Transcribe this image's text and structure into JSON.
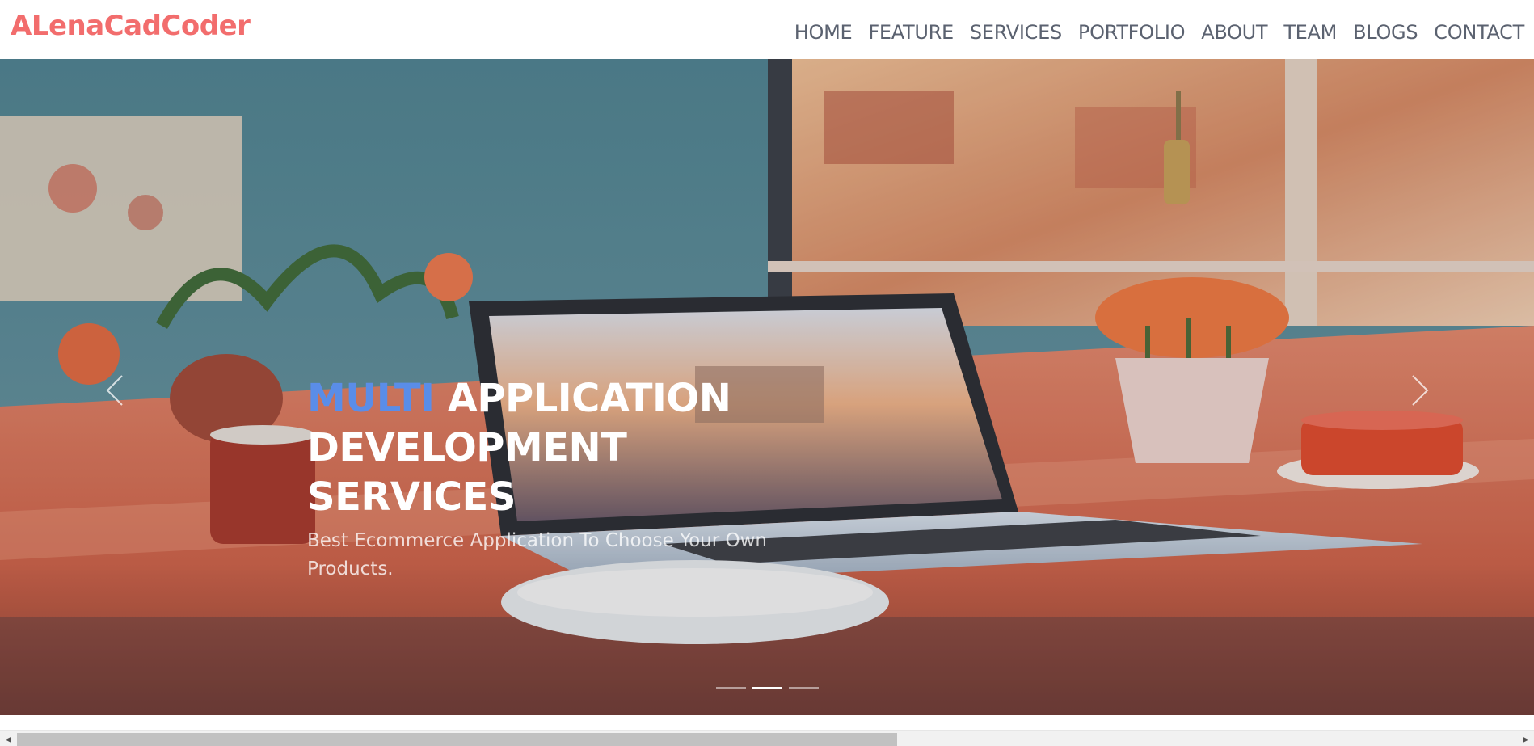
{
  "header": {
    "brand": "ALenaCadCoder",
    "nav": [
      {
        "label": "HOME"
      },
      {
        "label": "FEATURE"
      },
      {
        "label": "SERVICES"
      },
      {
        "label": "PORTFOLIO"
      },
      {
        "label": "ABOUT"
      },
      {
        "label": "TEAM"
      },
      {
        "label": "BLOGS"
      },
      {
        "label": "CONTACT"
      }
    ]
  },
  "hero": {
    "headline_accent": "MULTI",
    "headline_rest": "APPLICATION DEVELOPMENT SERVICES",
    "subtext": "Best Ecommerce Application To Choose Your Own Products.",
    "prev_icon": "chevron-left-icon",
    "next_icon": "chevron-right-icon",
    "slides_count": 3,
    "active_slide": 2
  },
  "colors": {
    "brand": "#f26d6d",
    "nav_text": "#5b6270",
    "accent": "#5a8de8"
  },
  "scrollbar": {
    "left_icon": "◂",
    "right_icon": "▸"
  }
}
